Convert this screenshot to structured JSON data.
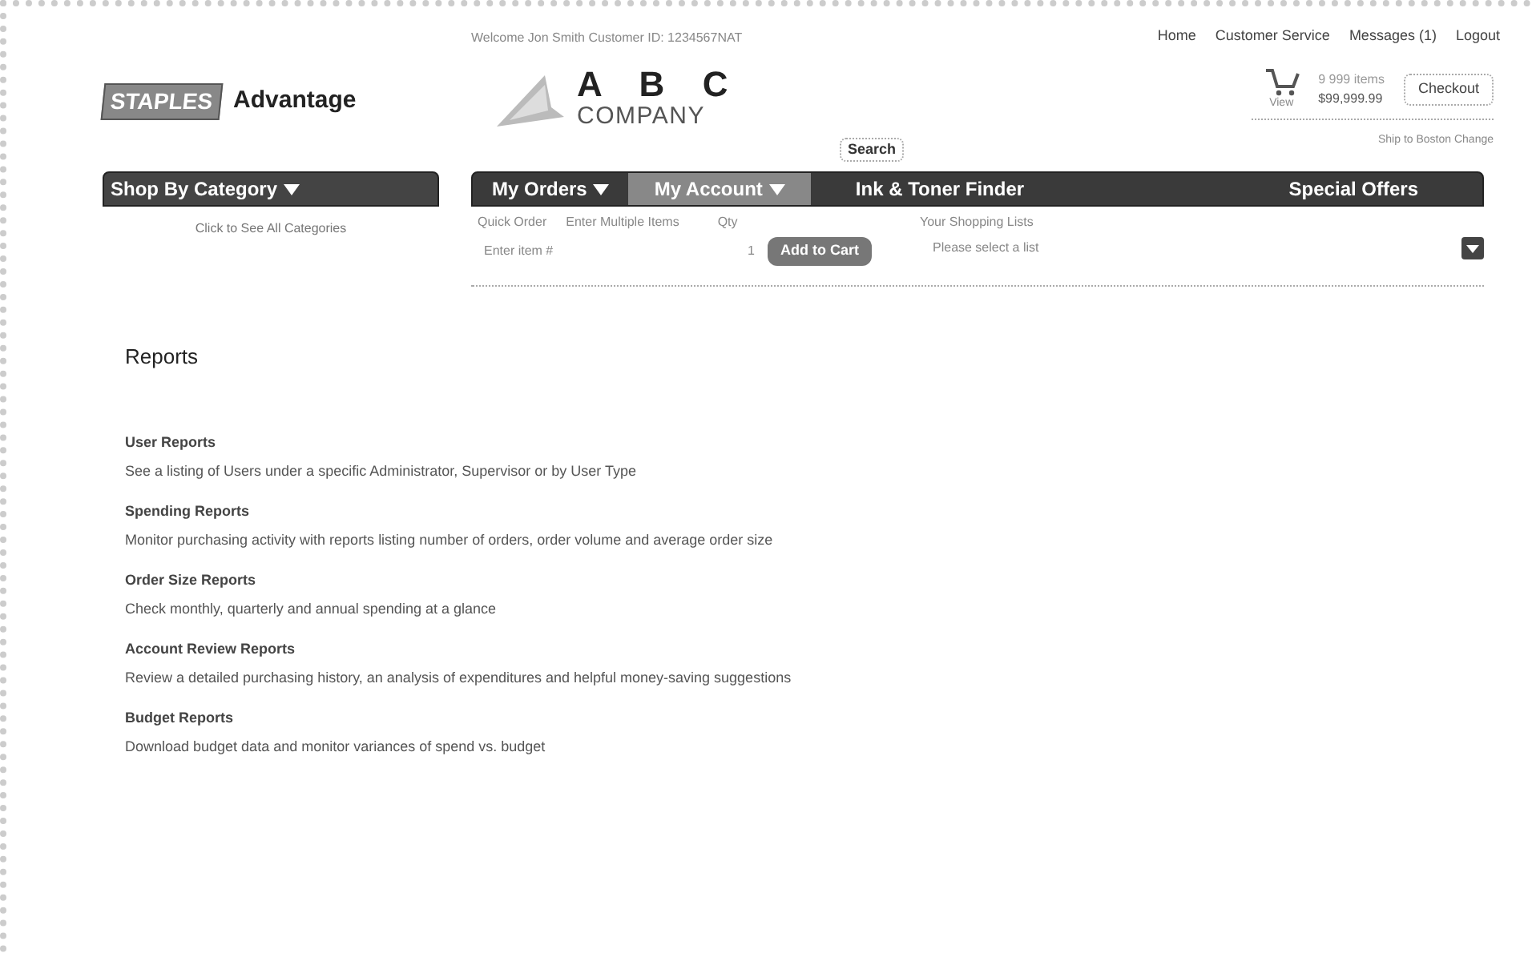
{
  "brand": {
    "logo": "STAPLES",
    "name": "Advantage"
  },
  "welcome": "Welcome Jon Smith  Customer ID: 1234567NAT",
  "company": {
    "letters": "A B C",
    "name": "COMPANY"
  },
  "top_links": [
    "Home",
    "Customer Service",
    "Messages (1)",
    "Logout"
  ],
  "cart": {
    "view": "View",
    "items": "9 999 items",
    "total": "$99,999.99",
    "checkout": "Checkout"
  },
  "ship_to": "Ship to Boston Change",
  "search_button": "Search",
  "category_menu": {
    "label": "Shop By Category",
    "link": "Click to See All Categories"
  },
  "nav": [
    {
      "label": "My Orders",
      "dropdown": true,
      "selected": false
    },
    {
      "label": "My Account",
      "dropdown": true,
      "selected": true
    },
    {
      "label": "Ink & Toner Finder",
      "dropdown": false,
      "selected": false
    },
    {
      "label": "Special Offers",
      "dropdown": false,
      "selected": false
    }
  ],
  "quick_order": {
    "label": "Quick Order",
    "multiple_link": "Enter Multiple Items",
    "qty_label": "Qty",
    "item_placeholder": "Enter item #",
    "qty": "1",
    "add_button": "Add to Cart",
    "lists_label": "Your Shopping Lists",
    "lists_placeholder": "Please select a list"
  },
  "page_title": "Reports",
  "reports": [
    {
      "title": "User Reports",
      "description": "See a listing of Users under a specific Administrator, Supervisor or by User Type"
    },
    {
      "title": "Spending Reports",
      "description": "Monitor purchasing activity with reports listing number of orders, order volume and average order size"
    },
    {
      "title": "Order Size Reports",
      "description": "Check monthly, quarterly and annual spending at a glance"
    },
    {
      "title": "Account Review Reports",
      "description": "Review a detailed purchasing history, an analysis of expenditures and helpful money-saving suggestions"
    },
    {
      "title": "Budget Reports",
      "description": "Download budget data and monitor variances of spend vs. budget"
    }
  ]
}
